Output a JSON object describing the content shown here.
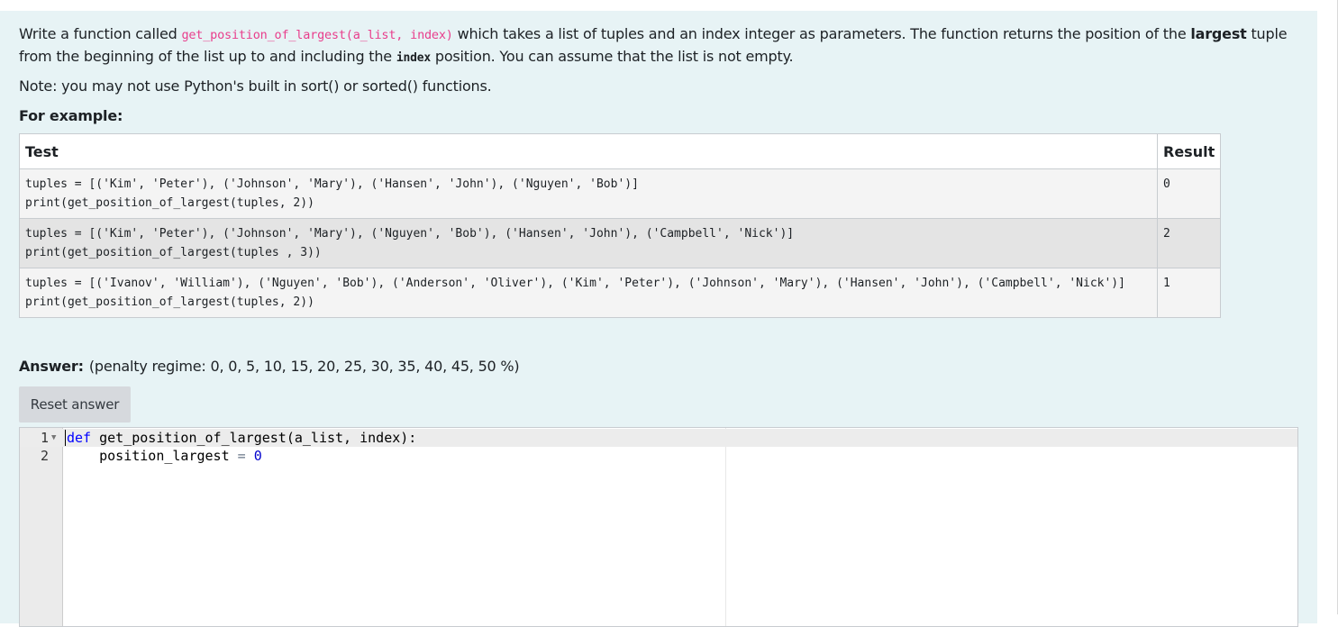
{
  "question": {
    "intro_pre": "Write a function called ",
    "function_signature": "get_position_of_largest(a_list, index)",
    "intro_mid": " which takes a list of tuples and an index integer as parameters. The function returns the position of the ",
    "bold_word": "largest",
    "intro_post": " tuple from the beginning of the list up to and including the ",
    "index_word": "index",
    "intro_end": " position. You can assume that the list is not empty.",
    "note": "Note: you may not use Python's built in sort() or sorted() functions.",
    "example_heading": "For example:"
  },
  "examples": {
    "headers": {
      "test": "Test",
      "result": "Result"
    },
    "rows": [
      {
        "test": "tuples = [('Kim', 'Peter'), ('Johnson', 'Mary'), ('Hansen', 'John'), ('Nguyen', 'Bob')]\nprint(get_position_of_largest(tuples, 2))",
        "result": "0"
      },
      {
        "test": "tuples = [('Kim', 'Peter'), ('Johnson', 'Mary'), ('Nguyen', 'Bob'), ('Hansen', 'John'), ('Campbell', 'Nick')]\nprint(get_position_of_largest(tuples , 3))",
        "result": "2"
      },
      {
        "test": "tuples = [('Ivanov', 'William'), ('Nguyen', 'Bob'), ('Anderson', 'Oliver'), ('Kim', 'Peter'), ('Johnson', 'Mary'), ('Hansen', 'John'), ('Campbell', 'Nick')]\nprint(get_position_of_largest(tuples, 2))",
        "result": "1"
      }
    ]
  },
  "answer": {
    "label": "Answer:",
    "penalty": "(penalty regime: 0, 0, 5, 10, 15, 20, 25, 30, 35, 40, 45, 50 %)",
    "reset_label": "Reset answer"
  },
  "editor": {
    "lines": [
      {
        "num": "1",
        "keyword": "def",
        "rest": " get_position_of_largest(a_list, index):"
      },
      {
        "num": "2",
        "ident": "    position_largest",
        "op": " = ",
        "number": "0"
      }
    ]
  }
}
